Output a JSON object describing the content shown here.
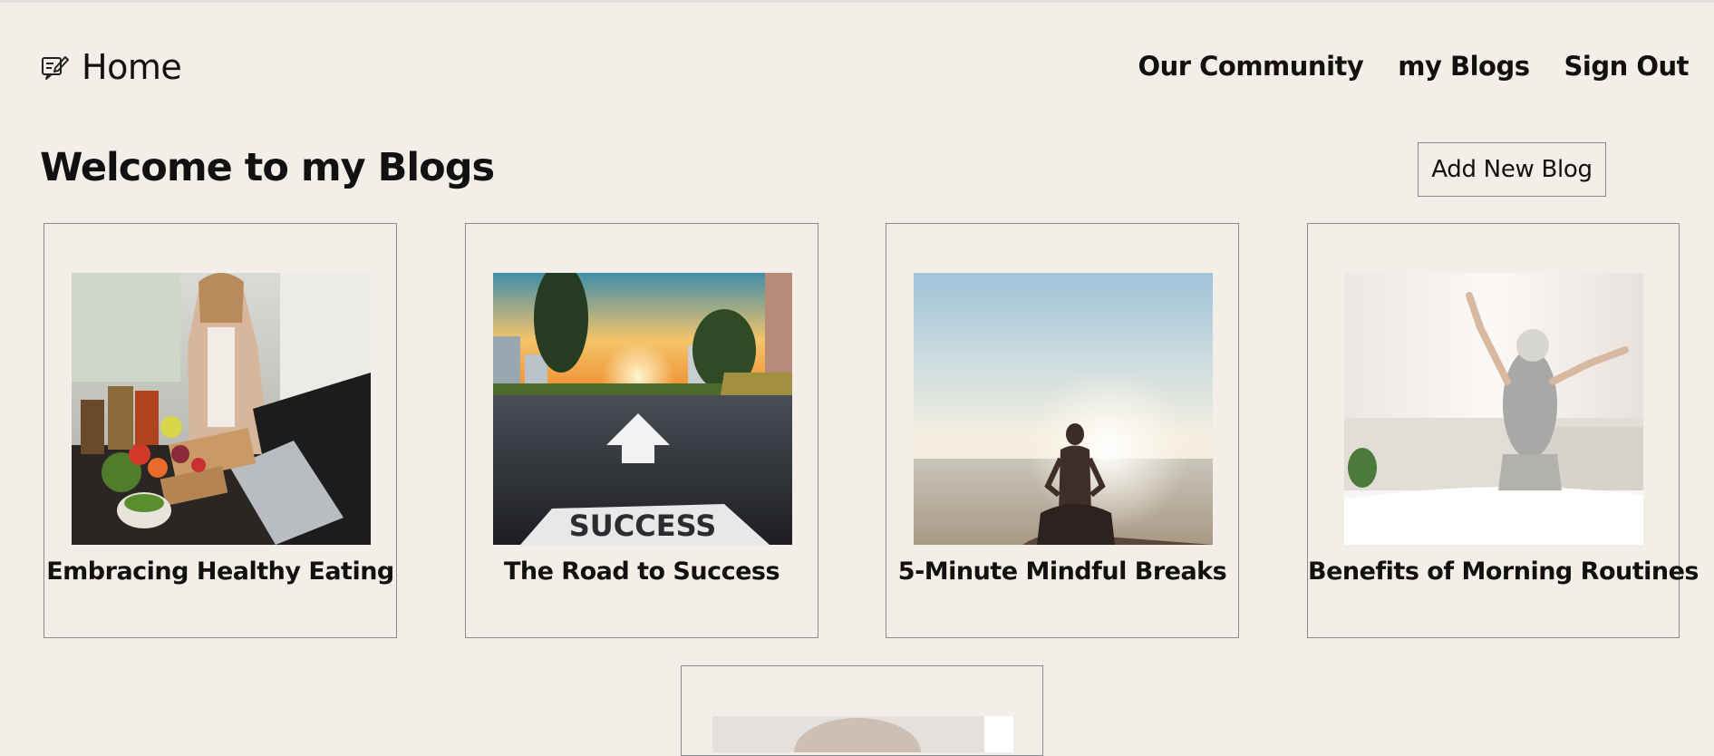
{
  "header": {
    "home_icon": "notepad-pencil-icon",
    "home_label": "Home",
    "nav": [
      {
        "label": "Our Community"
      },
      {
        "label": "my Blogs"
      },
      {
        "label": "Sign Out"
      }
    ]
  },
  "main": {
    "welcome_title": "Welcome to my Blogs",
    "add_button_label": "Add New Blog",
    "blogs": [
      {
        "title": "Embracing Healthy Eating",
        "image": "woman-cooking-kitchen-laptop"
      },
      {
        "title": "The Road to Success",
        "image": "road-arrow-success-sunset"
      },
      {
        "title": "5-Minute Mindful Breaks",
        "image": "meditation-by-sea-sunrise"
      },
      {
        "title": "Benefits of Morning Routines",
        "image": "woman-stretching-bedroom"
      },
      {
        "title": "",
        "image": "partial-blurred-photo"
      }
    ]
  },
  "colors": {
    "background": "#f3eee7",
    "text": "#111111",
    "card_border": "#8c8c8c"
  }
}
